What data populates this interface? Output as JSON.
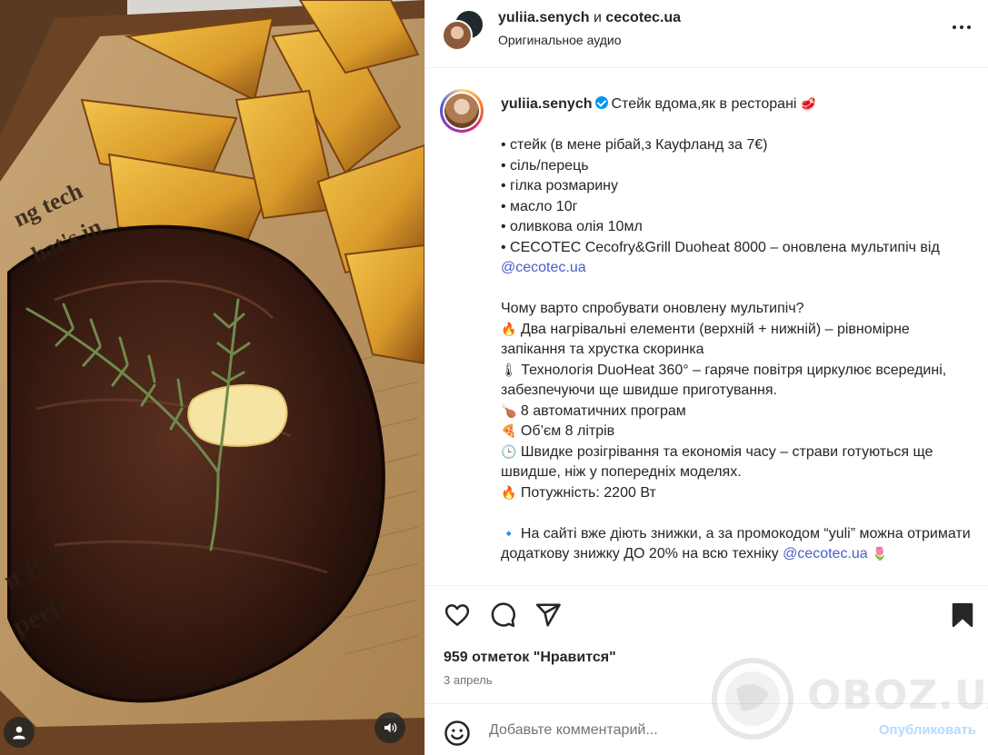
{
  "header": {
    "user1": "yuliia.senych",
    "separator": "и",
    "user2": "cecotec.ua",
    "audio": "Оригинальное аудио"
  },
  "caption": {
    "username": "yuliia.senych",
    "title": "Стейк вдома,як в ресторані",
    "title_emoji": "🥩",
    "ingredients": [
      "• стейк (в мене рібай,з Кауфланд за 7€)",
      "• сіль/перець",
      "• гілка розмарину",
      "• масло 10г",
      "• оливкова олія 10мл",
      "• CECOTEC Cecofry&Grill Duoheat 8000 – оновлена мультипіч від"
    ],
    "mention1": "@cecotec.ua",
    "question": "Чому варто спробувати оновлену мультипіч?",
    "features": [
      {
        "emoji": "🔥",
        "text": "Два нагрівальні елементи (верхній + нижній) – рівномірне запікання та хрустка скоринка"
      },
      {
        "emoji": "🌡",
        "text": "Технологія DuoHeat 360° – гаряче повітря циркулює всередині, забезпечуючи ще швидше приготування."
      },
      {
        "emoji": "🍗",
        "text": "8 автоматичних програм"
      },
      {
        "emoji": "🍕",
        "text": "Об’єм 8 літрів"
      },
      {
        "emoji": "🕒",
        "text": "Швидке розігрівання та економія часу – страви готуються ще швидше, ніж у попередніх моделях."
      },
      {
        "emoji": "🔥",
        "text": "Потужність: 2200 Вт"
      }
    ],
    "promo_emoji": "🔹",
    "promo_text": "На сайті вже діють знижки, а за промокодом “yuli” можна отримати додаткову знижку ДО 20% на всю техніку",
    "mention2": "@cecotec.ua",
    "promo_end_emoji": "🌷"
  },
  "stats": {
    "likes": "959 отметок \"Нравится\"",
    "date": "3 апрель"
  },
  "comment": {
    "placeholder": "Добавьте комментарий...",
    "post_label": "Опубликовать"
  },
  "watermark": {
    "text": "OBOZ.UA"
  },
  "icons": {
    "like": "heart-icon",
    "comment": "comment-icon",
    "share": "send-icon",
    "save": "bookmark-icon",
    "emoji": "smiley-icon",
    "more": "more-icon",
    "tagged_users": "user-icon",
    "audio": "speaker-icon"
  },
  "colors": {
    "link": "#4a5ec6",
    "verified": "#0095f6",
    "post_button_disabled": "#b3dbff",
    "secondary_text": "#737373"
  }
}
